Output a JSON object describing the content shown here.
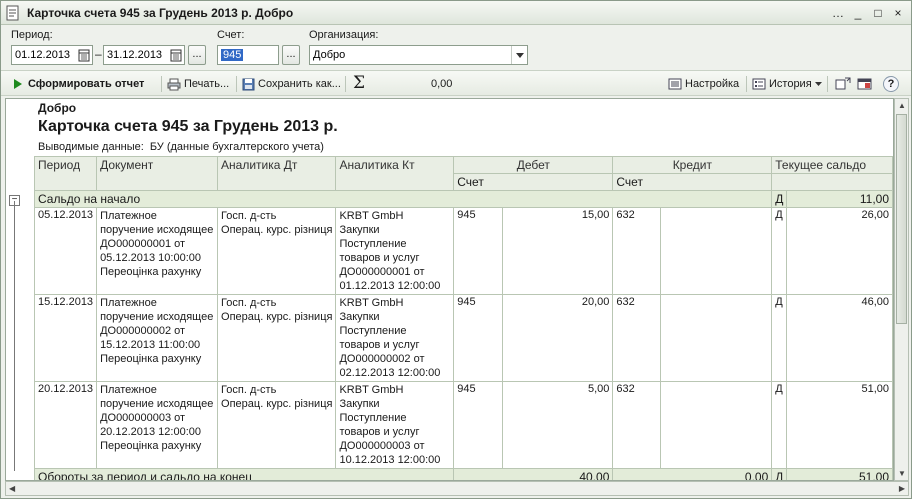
{
  "window": {
    "title": "Карточка счета 945 за Грудень 2013 р. Добро",
    "buttons": [
      "…",
      "_",
      "□",
      "×"
    ]
  },
  "filters": {
    "period_label": "Период:",
    "date_from": "01.12.2013",
    "dash": "–",
    "date_to": "31.12.2013",
    "more_button": "...",
    "account_label": "Счет:",
    "account_value": "945",
    "org_label": "Организация:",
    "org_value": "Добро"
  },
  "toolbar": {
    "generate": "Сформировать отчет",
    "print": "Печать...",
    "save": "Сохранить как...",
    "sigma": "Σ",
    "sum_value": "0,00",
    "settings": "Настройка",
    "history": "История",
    "help": "?"
  },
  "report": {
    "org": "Добро",
    "title": "Карточка счета 945 за Грудень 2013 р.",
    "output_label": "Выводимые данные:",
    "output_value": "БУ (данные бухгалтерского учета)",
    "headers": {
      "period": "Период",
      "document": "Документ",
      "analytics_dt": "Аналитика Дт",
      "analytics_kt": "Аналитика Кт",
      "debit": "Дебет",
      "credit": "Кредит",
      "balance": "Текущее сальдо",
      "account": "Счет"
    },
    "opening": {
      "label": "Сальдо на начало",
      "side": "Д",
      "value": "11,00"
    },
    "rows": [
      {
        "period": "05.12.2013",
        "document": [
          "Платежное",
          "поручение исходящее",
          "ДО000000001 от",
          "05.12.2013 10:00:00",
          "Переоцінка рахунку"
        ],
        "analytics_dt": [
          "Госп. д-сть",
          "Операц. курс. різниця"
        ],
        "analytics_kt": [
          "KRBT GmbH",
          "Закупки",
          "Поступление",
          "товаров и услуг",
          "ДО000000001 от",
          "01.12.2013 12:00:00"
        ],
        "debit_account": "945",
        "debit_sum": "15,00",
        "credit_account": "632",
        "credit_sum": "",
        "balance_side": "Д",
        "balance": "26,00"
      },
      {
        "period": "15.12.2013",
        "document": [
          "Платежное",
          "поручение исходящее",
          "ДО000000002 от",
          "15.12.2013 11:00:00",
          "Переоцінка рахунку"
        ],
        "analytics_dt": [
          "Госп. д-сть",
          "Операц. курс. різниця"
        ],
        "analytics_kt": [
          "KRBT GmbH",
          "Закупки",
          "Поступление",
          "товаров и услуг",
          "ДО000000002 от",
          "02.12.2013 12:00:00"
        ],
        "debit_account": "945",
        "debit_sum": "20,00",
        "credit_account": "632",
        "credit_sum": "",
        "balance_side": "Д",
        "balance": "46,00"
      },
      {
        "period": "20.12.2013",
        "document": [
          "Платежное",
          "поручение исходящее",
          "ДО000000003 от",
          "20.12.2013 12:00:00",
          "Переоцінка рахунку"
        ],
        "analytics_dt": [
          "Госп. д-сть",
          "Операц. курс. різниця"
        ],
        "analytics_kt": [
          "KRBT GmbH",
          "Закупки",
          "Поступление",
          "товаров и услуг",
          "ДО000000003 от",
          "10.12.2013 12:00:00"
        ],
        "debit_account": "945",
        "debit_sum": "5,00",
        "credit_account": "632",
        "credit_sum": "",
        "balance_side": "Д",
        "balance": "51,00"
      }
    ],
    "totals": {
      "label": "Обороты за период и сальдо на конец",
      "debit": "40,00",
      "credit": "0,00",
      "side": "Д",
      "balance": "51,00"
    }
  }
}
